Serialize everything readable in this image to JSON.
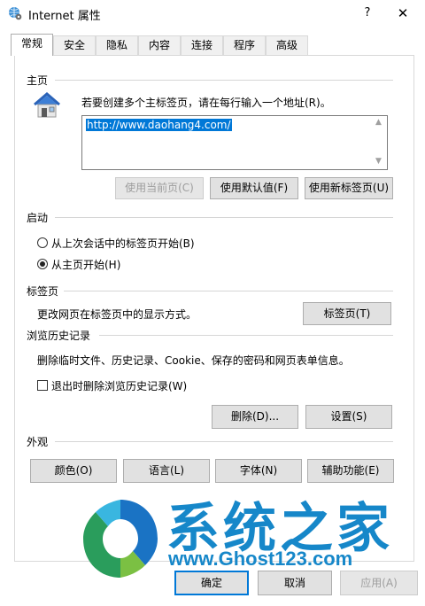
{
  "window": {
    "title": "Internet 属性",
    "help": "?",
    "close": "✕"
  },
  "tabs": [
    "常规",
    "安全",
    "隐私",
    "内容",
    "连接",
    "程序",
    "高级"
  ],
  "homepage": {
    "group": "主页",
    "instruction": "若要创建多个主标签页，请在每行输入一个地址(R)。",
    "url": "http://www.daohang4.com/",
    "btn_current": "使用当前页(C)",
    "btn_default": "使用默认值(F)",
    "btn_newtab": "使用新标签页(U)"
  },
  "startup": {
    "group": "启动",
    "opt_last_session": "从上次会话中的标签页开始(B)",
    "opt_home": "从主页开始(H)",
    "selected": "opt_home"
  },
  "tabs_section": {
    "group": "标签页",
    "desc": "更改网页在标签页中的显示方式。",
    "btn": "标签页(T)"
  },
  "history": {
    "group": "浏览历史记录",
    "desc": "删除临时文件、历史记录、Cookie、保存的密码和网页表单信息。",
    "checkbox": "退出时删除浏览历史记录(W)",
    "checked": false,
    "btn_delete": "删除(D)...",
    "btn_settings": "设置(S)"
  },
  "appearance": {
    "group": "外观",
    "btn_colors": "颜色(O)",
    "btn_languages": "语言(L)",
    "btn_fonts": "字体(N)",
    "btn_accessibility": "辅助功能(E)"
  },
  "footer": {
    "ok": "确定",
    "cancel": "取消",
    "apply": "应用(A)"
  },
  "watermark": {
    "cn": "系统之家",
    "url": "www.Ghost123.com"
  },
  "colors": {
    "accent": "#0078d7",
    "watermark": "#1687c9"
  }
}
